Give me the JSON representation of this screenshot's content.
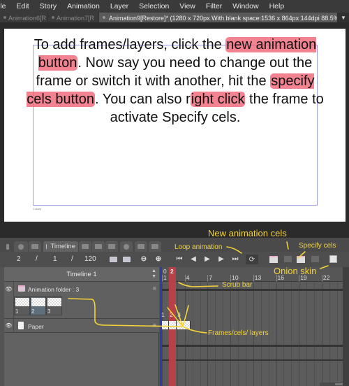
{
  "menubar": {
    "items": [
      "ile",
      "Edit",
      "Story",
      "Animation",
      "Layer",
      "Selection",
      "View",
      "Filter",
      "Window",
      "Help"
    ]
  },
  "document_tabs": [
    {
      "label": "Animation6[R",
      "active": false
    },
    {
      "label": "Animation7[R",
      "active": false
    },
    {
      "label": "Animation9[Restore]* (1280 x 720px With blank space:1536 x 864px 144dpi 88.5%)",
      "active": true
    }
  ],
  "tab_menu_icon": "chevron-down-icon",
  "canvas": {
    "instruction_parts": [
      {
        "text": "To add frames/layers, click the ",
        "highlight": false
      },
      {
        "text": "new animation button",
        "highlight": true
      },
      {
        "text": ".  Now say you need to change out the frame or switch it with another, hit the ",
        "highlight": false
      },
      {
        "text": "specify cels button",
        "highlight": true
      },
      {
        "text": ". You can also r",
        "highlight": false
      },
      {
        "text": "ight click",
        "highlight": true
      },
      {
        "text": " the frame to activate Specify cels.",
        "highlight": false
      }
    ],
    "story_label": "1 story",
    "highlight_color": "#f05a6e"
  },
  "panel": {
    "active_tab": "Timeline",
    "toolbar": {
      "current_frame": "2",
      "sep1": "/",
      "start_frame": "1",
      "sep2": "/",
      "end_frame": "120"
    },
    "timeline_name": "Timeline 1",
    "layers": [
      {
        "name": "Animation folder : 3",
        "type": "animation-folder",
        "cels": [
          "1",
          "2",
          "3"
        ],
        "selected_cel": "2"
      },
      {
        "name": "Paper",
        "type": "paper"
      }
    ],
    "ruler": {
      "top_labels": [
        "0",
        "2"
      ],
      "numbers": [
        "1",
        "4",
        "7",
        "10",
        "13",
        "16",
        "19",
        "22"
      ],
      "current_frame": "2"
    },
    "frame_numbers": [
      "1",
      "2",
      "3"
    ]
  },
  "annotations": {
    "new_animation_cels": "New animation cels",
    "loop_animation": "Loop animation",
    "specify_cels": "Specify cels",
    "onion_skin": "Onion skin",
    "scrub_bar": "Scrub bar",
    "frames_cels_layers": "Frames/cels/ layers",
    "color": "#f3d23a"
  },
  "colors": {
    "playhead": "#b84048",
    "start_marker": "#2a3ab8"
  }
}
